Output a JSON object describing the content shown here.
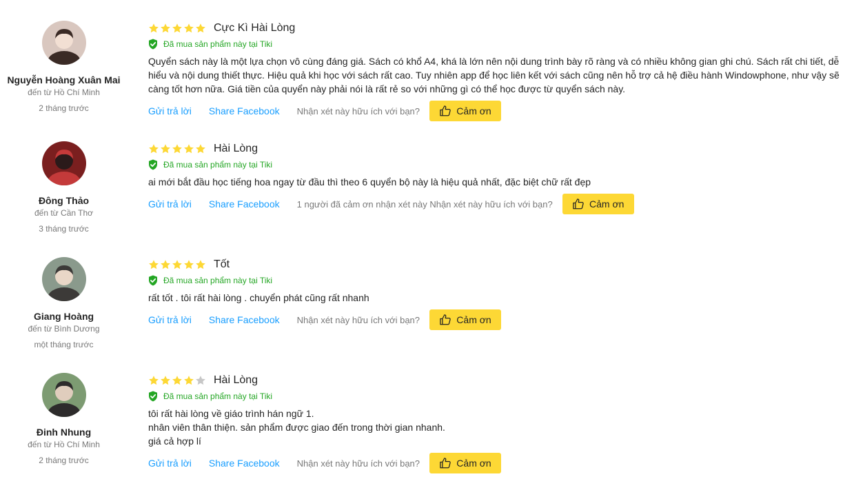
{
  "reviews": [
    {
      "author": "Nguyễn Hoàng Xuân Mai",
      "city": "đến từ Hồ Chí Minh",
      "time": "2 tháng trước",
      "rating": 5,
      "title": "Cực Kì Hài Lòng",
      "verified": "Đã mua sản phẩm này tại Tiki",
      "body": [
        "Quyển sách này là một lựa chọn vô cùng đáng giá. Sách có khổ A4, khá là lớn nên nội dung trình bày rõ ràng và có nhiều không gian ghi chú. Sách rất chi tiết, dễ",
        "hiểu và nội dung thiết thực. Hiệu quả khi học với sách rất cao. Tuy nhiên app để học liên kết với sách cũng nên hỗ trợ cả hệ điều hành Windowphone, như vậy sẽ",
        "càng tốt hơn nữa. Giá tiền của quyển này phải nói là rất rẻ so với những gì có thể học được từ quyển sách này."
      ],
      "reply_label": "Gửi trả lời",
      "share_label": "Share Facebook",
      "helpful_text": "Nhận xét này hữu ích với bạn?",
      "thanks_label": "Cảm ơn"
    },
    {
      "author": "Đông Thảo",
      "city": "đến từ Cần Thơ",
      "time": "3 tháng trước",
      "rating": 5,
      "title": "Hài Lòng",
      "verified": "Đã mua sản phẩm này tại Tiki",
      "body": [
        "ai mới bắt đầu học tiếng hoa ngay từ đầu thì theo 6 quyển bộ này là hiệu quả nhất, đặc biệt chữ rất đẹp"
      ],
      "reply_label": "Gửi trả lời",
      "share_label": "Share Facebook",
      "helpful_text": "1 người đã cảm ơn nhận xét này Nhận xét này hữu ích với bạn?",
      "thanks_label": "Cảm ơn"
    },
    {
      "author": "Giang Hoàng",
      "city": "đến từ Bình Dương",
      "time": "một tháng trước",
      "rating": 5,
      "title": "Tốt",
      "verified": "Đã mua sản phẩm này tại Tiki",
      "body": [
        "rất tốt . tôi rất hài lòng . chuyển phát cũng rất nhanh"
      ],
      "reply_label": "Gửi trả lời",
      "share_label": "Share Facebook",
      "helpful_text": "Nhận xét này hữu ích với bạn?",
      "thanks_label": "Cảm ơn"
    },
    {
      "author": "Đinh Nhung",
      "city": "đến từ Hồ Chí Minh",
      "time": "2 tháng trước",
      "rating": 4,
      "title": "Hài Lòng",
      "verified": "Đã mua sản phẩm này tại Tiki",
      "body": [
        "tôi rất hài lòng về giáo trình hán ngữ 1.",
        "nhân viên thân thiện. sản phẩm được giao đến trong thời gian nhanh.",
        "giá cả hợp lí"
      ],
      "reply_label": "Gửi trả lời",
      "share_label": "Share Facebook",
      "helpful_text": "Nhận xét này hữu ích với bạn?",
      "thanks_label": "Cảm ơn"
    }
  ],
  "colors": {
    "star_filled": "#FDD835",
    "star_empty": "#C7C7C7",
    "verified_green": "#24A624",
    "link_blue": "#189EFF",
    "button_yellow": "#FDD835",
    "muted_text": "#787878"
  },
  "icons": {
    "star": "star-icon",
    "verified": "shield-check-icon",
    "thanks": "thumbs-up-icon",
    "avatar": "user-avatar-photo"
  }
}
